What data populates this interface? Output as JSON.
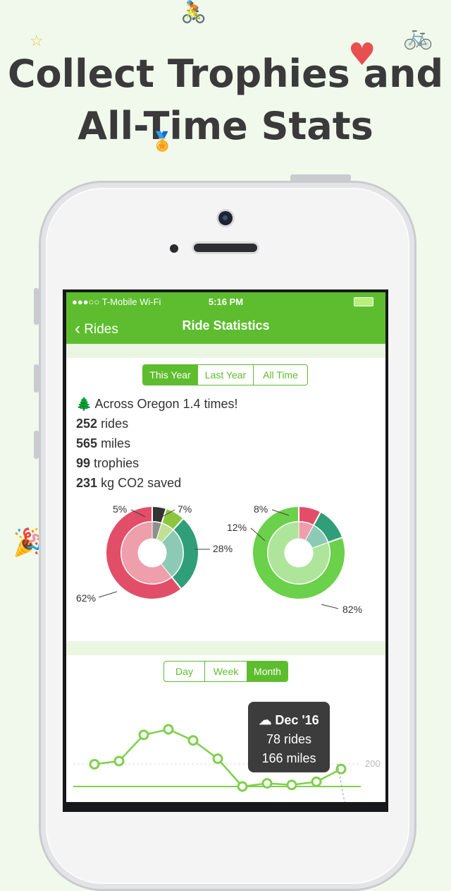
{
  "headline": {
    "line1": "Collect Trophies and",
    "line2": "All-Time Stats"
  },
  "status_bar": {
    "carrier": "●●●○○ T-Mobile Wi-Fi",
    "time": "5:16 PM"
  },
  "nav": {
    "back_label": "Rides",
    "title": "Ride Statistics"
  },
  "period_tabs": {
    "items": [
      "This Year",
      "Last Year",
      "All Time"
    ],
    "selected": "This Year"
  },
  "stats": {
    "headline": "Across Oregon 1.4 times!",
    "rides_value": "252",
    "rides_label": "rides",
    "miles_value": "565",
    "miles_label": "miles",
    "trophies_value": "99",
    "trophies_label": "trophies",
    "co2_value": "231",
    "co2_label": "kg CO2 saved"
  },
  "chart_data": [
    {
      "type": "pie",
      "values": [
        62,
        28,
        7,
        5
      ],
      "labels": [
        "62%",
        "28%",
        "7%",
        "5%"
      ],
      "icons": [
        "cloud-icon",
        "rain-icon",
        "sun-icon",
        ""
      ],
      "colors": [
        "#e24e68",
        "#2f9e79",
        "#8cc63f",
        "#333333"
      ]
    },
    {
      "type": "pie",
      "values": [
        82,
        12,
        8
      ],
      "labels": [
        "82%",
        "12%",
        "8%"
      ],
      "icons": [
        "bicycle-icon",
        "car-icon",
        ""
      ],
      "colors": [
        "#6bd04a",
        "#2f9e79",
        "#e24e68"
      ]
    },
    {
      "type": "line",
      "values_rel": [
        0.28,
        0.32,
        0.65,
        0.72,
        0.58,
        0.35,
        0.0,
        0.04,
        0.02,
        0.06,
        0.22
      ],
      "reference_label": "200",
      "color": "#7ed04b"
    }
  ],
  "granularity_tabs": {
    "items": [
      "Day",
      "Week",
      "Month"
    ],
    "selected": "Month"
  },
  "tooltip": {
    "title": "Dec '16",
    "rides": "78 rides",
    "miles": "166 miles"
  },
  "colors": {
    "accent": "#5ebd2e",
    "background": "#f1f9ec"
  }
}
